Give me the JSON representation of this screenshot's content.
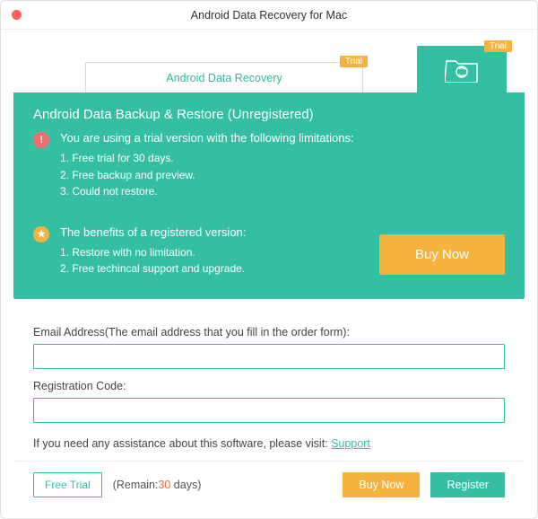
{
  "window": {
    "title": "Android Data Recovery for Mac"
  },
  "tabs": {
    "left_label": "Android Data Recovery",
    "left_badge": "Trial",
    "right_badge": "Trial"
  },
  "panel": {
    "title": "Android Data Backup & Restore (Unregistered)",
    "limitations_head": "You are using a trial version with the following limitations:",
    "limitations": [
      "1. Free trial for 30 days.",
      "2. Free backup and preview.",
      "3. Could not restore."
    ],
    "benefits_head": "The benefits of a registered version:",
    "benefits": [
      "1. Restore with no limitation.",
      "2. Free techincal support and upgrade."
    ],
    "buy_now_label": "Buy Now"
  },
  "form": {
    "email_label": "Email Address(The email address that you fill in the order form):",
    "email_value": "",
    "code_label": "Registration Code:",
    "code_value": "",
    "support_prefix": "If you need any assistance about this software, please visit: ",
    "support_link": "Support"
  },
  "footer": {
    "free_trial_label": "Free Trial",
    "remain_prefix": "(Remain:",
    "remain_days": "30",
    "remain_suffix": " days)",
    "buy_now_label": "Buy Now",
    "register_label": "Register"
  }
}
